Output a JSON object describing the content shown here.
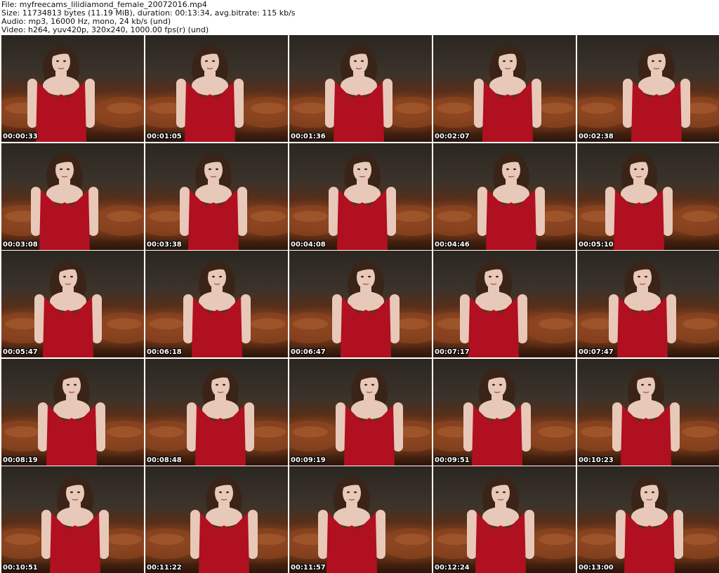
{
  "header": {
    "file_line": "File: myfreecams_lilidiamond_female_20072016.mp4",
    "size_line": "Size: 11734813 bytes (11.19 MiB), duration: 00:13:34, avg.bitrate: 115 kb/s",
    "audio_line": "Audio: mp3, 16000 Hz, mono, 24 kb/s (und)",
    "video_line": "Video: h264, yuv420p, 320x240, 1000.00 fps(r) (und)"
  },
  "colors": {
    "dress": "#b01020",
    "skin": "#e8c8b8",
    "hair": "#3a2418",
    "couch": "#7a3a1a"
  },
  "thumbnails": [
    {
      "timestamp": "00:00:33"
    },
    {
      "timestamp": "00:01:05"
    },
    {
      "timestamp": "00:01:36"
    },
    {
      "timestamp": "00:02:07"
    },
    {
      "timestamp": "00:02:38"
    },
    {
      "timestamp": "00:03:08"
    },
    {
      "timestamp": "00:03:38"
    },
    {
      "timestamp": "00:04:08"
    },
    {
      "timestamp": "00:04:46"
    },
    {
      "timestamp": "00:05:10"
    },
    {
      "timestamp": "00:05:47"
    },
    {
      "timestamp": "00:06:18"
    },
    {
      "timestamp": "00:06:47"
    },
    {
      "timestamp": "00:07:17"
    },
    {
      "timestamp": "00:07:47"
    },
    {
      "timestamp": "00:08:19"
    },
    {
      "timestamp": "00:08:48"
    },
    {
      "timestamp": "00:09:19"
    },
    {
      "timestamp": "00:09:51"
    },
    {
      "timestamp": "00:10:23"
    },
    {
      "timestamp": "00:10:51"
    },
    {
      "timestamp": "00:11:22"
    },
    {
      "timestamp": "00:11:57"
    },
    {
      "timestamp": "00:12:24"
    },
    {
      "timestamp": "00:13:00"
    }
  ]
}
